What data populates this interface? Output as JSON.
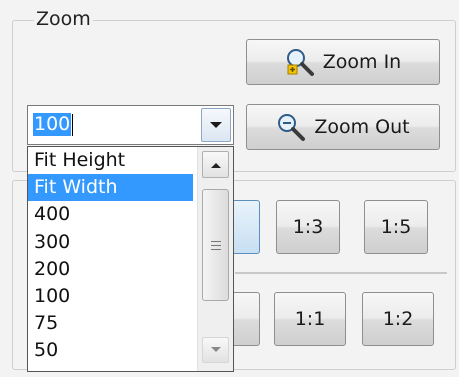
{
  "zoom_group": {
    "title": "Zoom"
  },
  "zoom_in": {
    "label": "Zoom In",
    "icon": "zoom-in-icon"
  },
  "zoom_out": {
    "label": "Zoom Out",
    "icon": "zoom-out-icon"
  },
  "zoom_combo": {
    "value": "100",
    "arrow_icon": "chevron-down-icon"
  },
  "zoom_list": {
    "items": [
      "Fit Height",
      "Fit Width",
      "400",
      "300",
      "200",
      "100",
      "75",
      "50"
    ],
    "selected": "Fit Width"
  },
  "ratio_buttons": {
    "row1": [
      "1:3",
      "1:5"
    ],
    "row2": [
      "1:1",
      "1:2"
    ]
  },
  "colors": {
    "selection": "#3399ff",
    "accent": "#d9a400"
  }
}
